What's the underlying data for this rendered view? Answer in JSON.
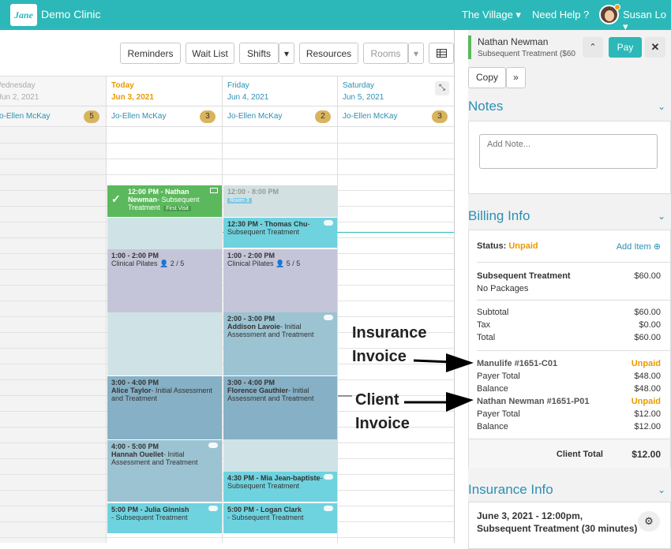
{
  "header": {
    "logo": "Jane",
    "clinic_name": "Demo Clinic",
    "location": "The Village ▾",
    "help": "Need Help ?",
    "user": "Susan Lo ▾"
  },
  "toolbar": {
    "reminders": "Reminders",
    "wait_list": "Wait List",
    "shifts": "Shifts",
    "resources": "Resources",
    "rooms": "Rooms",
    "caret": "▾"
  },
  "days": [
    {
      "name": "Wednesday",
      "date": "Jun 2, 2021",
      "staff": "Jo-Ellen McKay",
      "count": "5"
    },
    {
      "name": "Today",
      "date": "Jun 3, 2021",
      "staff": "Jo-Ellen McKay",
      "count": "3"
    },
    {
      "name": "Friday",
      "date": "Jun 4, 2021",
      "staff": "Jo-Ellen McKay",
      "count": "2"
    },
    {
      "name": "Saturday",
      "date": "Jun 5, 2021",
      "staff": "Jo-Ellen McKay",
      "count": "3"
    }
  ],
  "appointments": {
    "a1": {
      "time": "12:00 PM - Nathan Newman",
      "desc": "- Subsequent Treatment",
      "tag": "First Visit"
    },
    "a2": {
      "time": "12:00 - 8:00 PM",
      "tag": "Room 3"
    },
    "a3": {
      "time": "12:30 PM - Thomas Chu",
      "desc": "- Subsequent Treatment"
    },
    "a4": {
      "time": "1:00 - 2:00 PM",
      "desc": "Clinical Pilates",
      "count": "2 / 5"
    },
    "a5": {
      "time": "1:00 - 2:00 PM",
      "desc": "Clinical Pilates",
      "count": "5 / 5"
    },
    "a6": {
      "time": "2:00 - 3:00 PM",
      "name": "Addison Lavoie",
      "desc": "- Initial Assessment and Treatment"
    },
    "a7": {
      "time": "3:00 - 4:00 PM",
      "name": "Alice Taylor",
      "desc": "- Initial Assessment and Treatment"
    },
    "a8": {
      "time": "3:00 - 4:00 PM",
      "name": "Florence Gauthier",
      "desc": "- Initial Assessment and Treatment"
    },
    "a9": {
      "time": "4:00 - 5:00 PM",
      "name": "Hannah Ouellet",
      "desc": "- Initial Assessment and Treatment"
    },
    "a10": {
      "time": "4:30 PM - Mia Jean-baptiste",
      "desc": "- Subsequent Treatment"
    },
    "a11": {
      "time": "5:00 PM - Julia Ginnish",
      "desc": "- Subsequent Treatment"
    },
    "a12": {
      "time": "5:00 PM - Logan Clark",
      "desc": "- Subsequent Treatment"
    }
  },
  "panel": {
    "patient": "Nathan Newman",
    "subtitle": "Subsequent Treatment ($60",
    "pay": "Pay",
    "copy": "Copy",
    "more": "»",
    "notes_title": "Notes",
    "note_placeholder": "Add Note...",
    "billing_title": "Billing Info",
    "status_label": "Status:",
    "status": "Unpaid",
    "add_item": "Add Item",
    "item": "Subsequent Treatment",
    "item_price": "$60.00",
    "packages": "No Packages",
    "subtotal": "Subtotal",
    "subtotal_v": "$60.00",
    "tax": "Tax",
    "tax_v": "$0.00",
    "total": "Total",
    "total_v": "$60.00",
    "inv1": "Manulife #1651-C01",
    "inv1_status": "Unpaid",
    "payer_total": "Payer Total",
    "inv1_payer": "$48.00",
    "balance": "Balance",
    "inv1_balance": "$48.00",
    "inv2": "Nathan Newman #1651-P01",
    "inv2_status": "Unpaid",
    "inv2_payer": "$12.00",
    "inv2_balance": "$12.00",
    "client_total": "Client Total",
    "client_total_v": "$12.00",
    "insurance_title": "Insurance Info",
    "ins_line1": "June 3, 2021 - 12:00pm,",
    "ins_line2": "Subsequent Treatment (30 minutes)"
  },
  "annotations": {
    "ins1": "Insurance",
    "ins2": "Invoice",
    "cli1": "Client",
    "cli2": "Invoice"
  }
}
